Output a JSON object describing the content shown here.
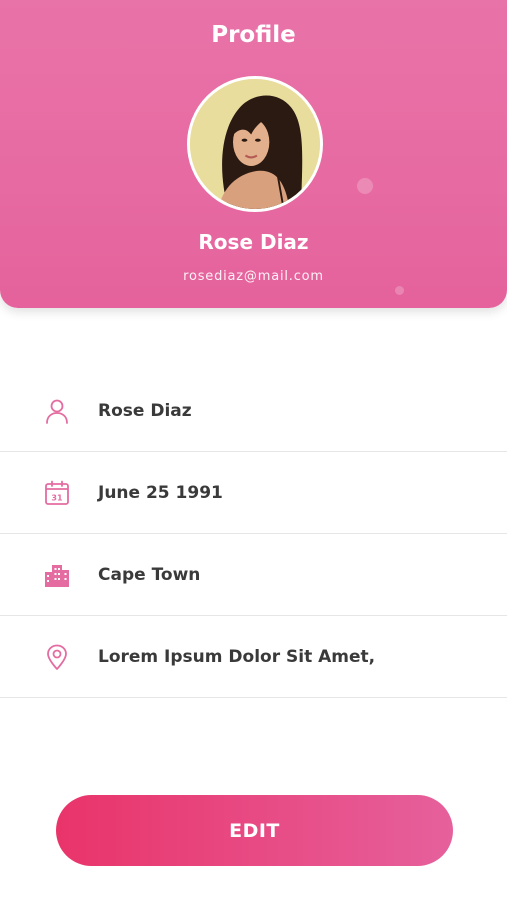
{
  "header": {
    "title": "Profile",
    "name": "Rose Diaz",
    "email": "rosediaz@mail.com"
  },
  "details": [
    {
      "icon": "person-icon",
      "value": "Rose Diaz"
    },
    {
      "icon": "calendar-icon",
      "value": "June 25 1991",
      "calendar_day": "31"
    },
    {
      "icon": "city-icon",
      "value": "Cape Town"
    },
    {
      "icon": "location-pin-icon",
      "value": "Lorem Ipsum Dolor Sit Amet,"
    }
  ],
  "actions": {
    "edit_label": "EDIT"
  },
  "colors": {
    "header_bg": "#e76aa2",
    "accent_pink": "#e6609c",
    "button_start": "#e9346a",
    "button_end": "#e6609c",
    "text_dark": "#3a3a3a"
  }
}
